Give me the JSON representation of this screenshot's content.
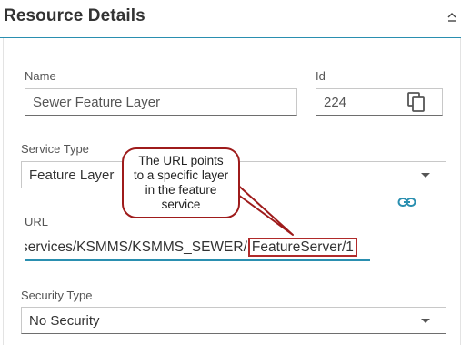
{
  "header": {
    "title": "Resource Details",
    "collapse_icon": "chevron-up-icon"
  },
  "form": {
    "name": {
      "label": "Name",
      "value": "Sewer Feature Layer"
    },
    "id": {
      "label": "Id",
      "value": "224",
      "copy_icon": "copy-icon"
    },
    "service_type": {
      "label": "Service Type",
      "value": "Feature Layer"
    },
    "url": {
      "label": "URL",
      "value_visible_prefix": "services/KSMMS/KSMMS_SEWER/",
      "value_highlighted": "FeatureServer/1",
      "link_icon": "link-icon"
    },
    "security_type": {
      "label": "Security Type",
      "value": "No Security"
    }
  },
  "callout": {
    "text_line1": "The URL points",
    "text_line2": "to a specific layer",
    "text_line3": "in the feature",
    "text_line4": "service"
  },
  "colors": {
    "accent": "#2a8fb0",
    "callout_border": "#9e1b1b",
    "highlight_border": "#b02a2a"
  }
}
